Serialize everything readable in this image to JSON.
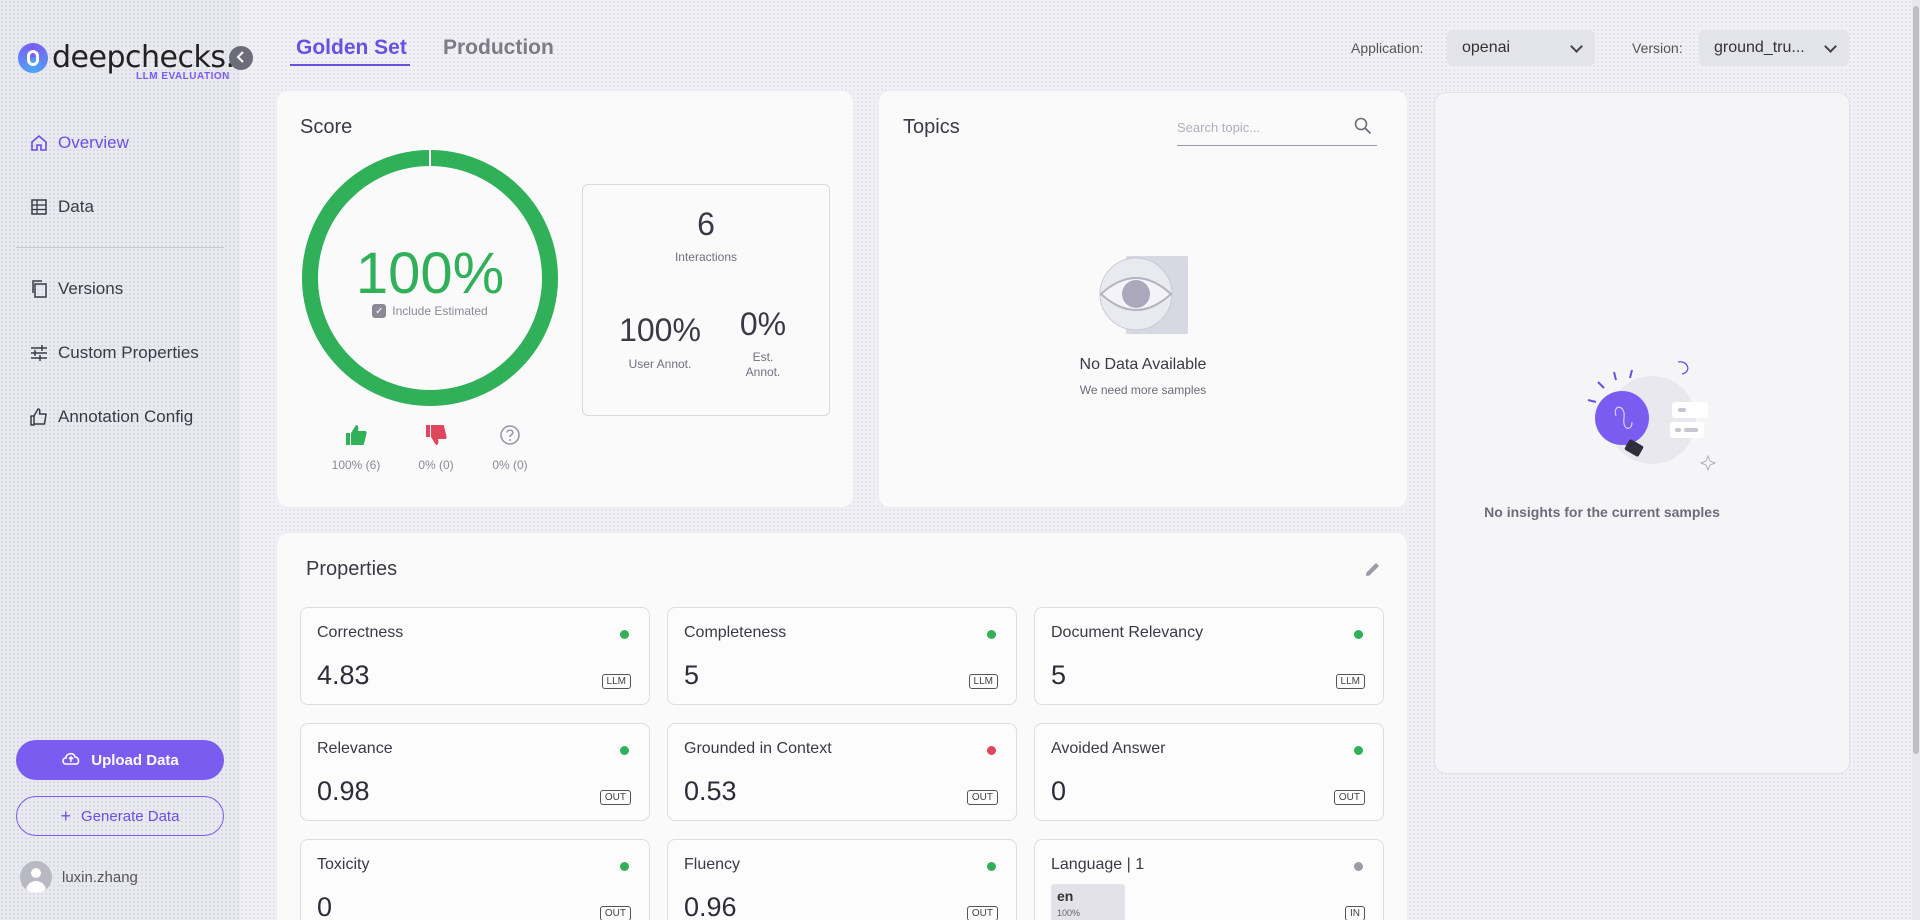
{
  "logo": {
    "text": "deepchecks.",
    "subtitle": "LLM EVALUATION"
  },
  "sidebar": {
    "items": [
      {
        "label": "Overview",
        "icon": "home-icon",
        "active": true
      },
      {
        "label": "Data",
        "icon": "table-icon"
      },
      {
        "label": "Versions",
        "icon": "copy-icon"
      },
      {
        "label": "Custom Properties",
        "icon": "sliders-icon"
      },
      {
        "label": "Annotation Config",
        "icon": "thumbs-up-icon"
      }
    ],
    "upload_label": "Upload Data",
    "generate_label": "Generate Data",
    "user": "luxin.zhang"
  },
  "header": {
    "tabs": [
      {
        "label": "Golden Set",
        "active": true
      },
      {
        "label": "Production"
      }
    ],
    "application_label": "Application:",
    "application_value": "openai",
    "version_label": "Version:",
    "version_value": "ground_tru..."
  },
  "score": {
    "title": "Score",
    "percent": "100%",
    "include_estimated": "Include Estimated",
    "good": "100% (6)",
    "bad": "0% (0)",
    "unknown": "0% (0)",
    "interactions_count": "6",
    "interactions_label": "Interactions",
    "user_annot_pct": "100%",
    "user_annot_label": "User Annot.",
    "est_annot_pct": "0%",
    "est_annot_label": "Est. Annot."
  },
  "topics": {
    "title": "Topics",
    "search_placeholder": "Search topic...",
    "empty_title": "No Data Available",
    "empty_sub": "We need more samples"
  },
  "insights": {
    "empty_text": "No insights for the current samples"
  },
  "properties": {
    "title": "Properties",
    "items": [
      {
        "name": "Correctness",
        "value": "4.83",
        "badge": "LLM",
        "status": "green"
      },
      {
        "name": "Completeness",
        "value": "5",
        "badge": "LLM",
        "status": "green"
      },
      {
        "name": "Document Relevancy",
        "value": "5",
        "badge": "LLM",
        "status": "green"
      },
      {
        "name": "Relevance",
        "value": "0.98",
        "badge": "OUT",
        "status": "green"
      },
      {
        "name": "Grounded in Context",
        "value": "0.53",
        "badge": "OUT",
        "status": "red"
      },
      {
        "name": "Avoided Answer",
        "value": "0",
        "badge": "OUT",
        "status": "green"
      },
      {
        "name": "Toxicity",
        "value": "0",
        "badge": "OUT",
        "status": "green"
      },
      {
        "name": "Fluency",
        "value": "0.96",
        "badge": "OUT",
        "status": "green"
      },
      {
        "name": "Language | 1",
        "value": "",
        "badge": "IN",
        "status": "gray",
        "chip_lang": "en",
        "chip_pct": "100%"
      }
    ]
  },
  "colors": {
    "accent": "#6b4fe0",
    "green": "#31b05a",
    "red": "#e0465e",
    "gray": "#9a9aa8"
  }
}
